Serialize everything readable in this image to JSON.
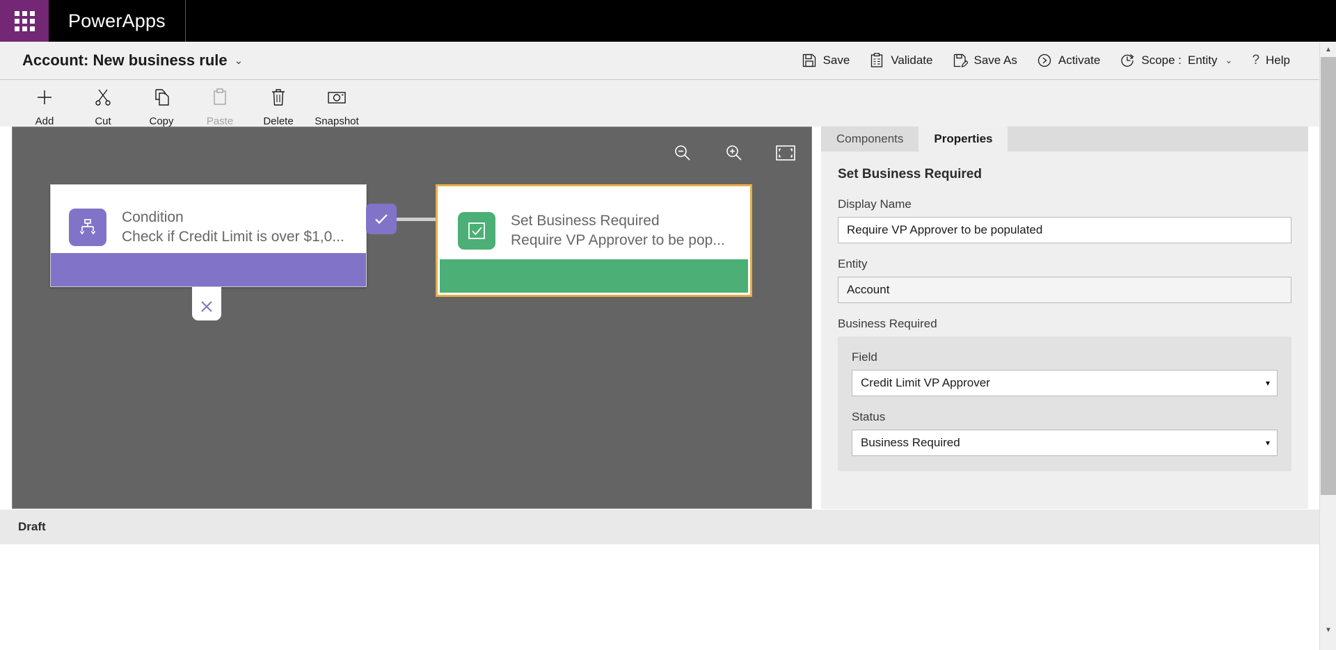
{
  "suite": {
    "waffle_icon": "waffle-grid-icon",
    "app_name": "PowerApps"
  },
  "command_bar": {
    "title": "Account: New business rule",
    "title_chevron": "⌄",
    "actions": [
      {
        "label": "Save",
        "icon": "save-icon",
        "disabled": false
      },
      {
        "label": "Validate",
        "icon": "validate-icon",
        "disabled": false
      },
      {
        "label": "Save As",
        "icon": "save-as-icon",
        "disabled": false
      },
      {
        "label": "Activate",
        "icon": "activate-icon",
        "disabled": false
      }
    ],
    "scope": {
      "icon": "scope-clock-icon",
      "label": "Scope :",
      "value": "Entity",
      "chevron": "⌄"
    },
    "help": {
      "icon": "question-mark-icon",
      "glyph": "?",
      "label": "Help"
    }
  },
  "ribbon": {
    "tools": [
      {
        "label": "Add",
        "icon": "plus-icon",
        "disabled": false
      },
      {
        "label": "Cut",
        "icon": "scissors-icon",
        "disabled": false
      },
      {
        "label": "Copy",
        "icon": "copy-icon",
        "disabled": false
      },
      {
        "label": "Paste",
        "icon": "clipboard-paste-icon",
        "disabled": true
      },
      {
        "label": "Delete",
        "icon": "trash-icon",
        "disabled": false
      },
      {
        "label": "Snapshot",
        "icon": "camera-icon",
        "disabled": false
      }
    ]
  },
  "canvas": {
    "background_color": "#646464",
    "zoom_controls": [
      {
        "name": "zoom-out-icon",
        "title": "Zoom out"
      },
      {
        "name": "zoom-in-icon",
        "title": "Zoom in"
      },
      {
        "name": "fit-to-screen-icon",
        "title": "Fit to screen"
      }
    ],
    "nodes": [
      {
        "type": "condition",
        "icon": "condition-branch-icon",
        "title": "Condition",
        "subtitle": "Check if Credit Limit is over $1,0...",
        "accent_color": "#8174c8",
        "selected": false
      },
      {
        "type": "action",
        "icon": "checkbox-checked-icon",
        "title": "Set Business Required",
        "subtitle": "Require VP Approver to be pop...",
        "accent_color": "#4caf76",
        "selected": true,
        "selection_color": "#e5af48"
      }
    ],
    "branches": [
      {
        "name": "true-branch-badge",
        "glyph": "✓",
        "label": "true"
      },
      {
        "name": "false-branch-badge",
        "glyph": "✕",
        "label": "false"
      }
    ]
  },
  "panel": {
    "tabs": [
      {
        "label": "Components",
        "active": false
      },
      {
        "label": "Properties",
        "active": true
      }
    ],
    "heading": "Set Business Required",
    "fields": [
      {
        "label": "Display Name",
        "value": "Require VP Approver to be populated",
        "kind": "text",
        "readonly": false
      },
      {
        "label": "Entity",
        "value": "Account",
        "kind": "text",
        "readonly": true
      }
    ],
    "group": {
      "label": "Business Required",
      "fields": [
        {
          "label": "Field",
          "value": "Credit Limit VP Approver",
          "kind": "select",
          "caret": "▾"
        },
        {
          "label": "Status",
          "value": "Business Required",
          "kind": "select",
          "caret": "▾"
        }
      ]
    }
  },
  "status_bar": {
    "text": "Draft"
  },
  "scrollbar": {
    "up_arrow": "▲",
    "down_arrow": "▼"
  },
  "colors": {
    "brand_purple": "#742774",
    "condition_purple": "#8174c8",
    "action_green": "#4caf76",
    "selection_gold": "#e5af48",
    "canvas_gray": "#646464"
  }
}
